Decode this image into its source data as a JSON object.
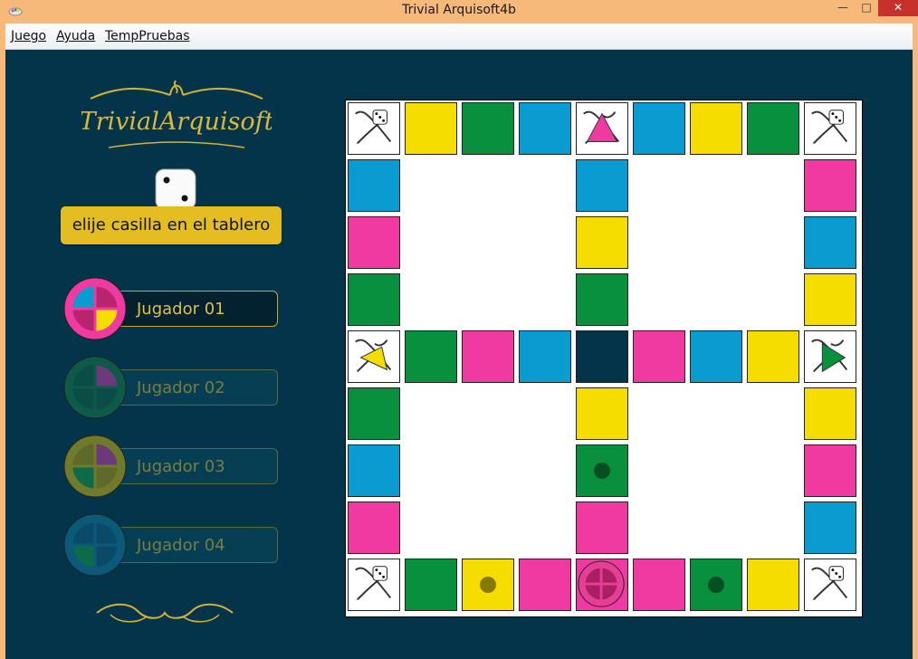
{
  "window": {
    "title": "Trivial Arquisoft4b",
    "icon": "app-icon",
    "controls": [
      "minimize",
      "maximize",
      "close"
    ]
  },
  "menu": [
    {
      "label": "Juego"
    },
    {
      "label": "Ayuda"
    },
    {
      "label": "TempPruebas"
    }
  ],
  "logo": {
    "text": "TrivialArquisoft"
  },
  "status": {
    "text": "elije casilla en el tablero"
  },
  "die": {
    "value": 2
  },
  "players": [
    {
      "name": "Jugador 01",
      "active": true
    },
    {
      "name": "Jugador 02",
      "active": false
    },
    {
      "name": "Jugador 03",
      "active": false
    },
    {
      "name": "Jugador 04",
      "active": false
    }
  ],
  "colors": {
    "yellow": "#f5dd00",
    "green": "#08903f",
    "blue": "#0a9cd0",
    "pink": "#f13aa1",
    "dark": "#04344a",
    "white": "#ffffff",
    "gold": "#e3bd21"
  },
  "board": {
    "size": 9,
    "cells": [
      {
        "r": 0,
        "c": 0,
        "color": "white",
        "icon": "dice-scroll-icon"
      },
      {
        "r": 0,
        "c": 1,
        "color": "yellow"
      },
      {
        "r": 0,
        "c": 2,
        "color": "green"
      },
      {
        "r": 0,
        "c": 3,
        "color": "blue"
      },
      {
        "r": 0,
        "c": 4,
        "color": "white",
        "icon": "pink-wedge-icon"
      },
      {
        "r": 0,
        "c": 5,
        "color": "blue"
      },
      {
        "r": 0,
        "c": 6,
        "color": "yellow"
      },
      {
        "r": 0,
        "c": 7,
        "color": "green"
      },
      {
        "r": 0,
        "c": 8,
        "color": "white",
        "icon": "dice-scroll-icon"
      },
      {
        "r": 1,
        "c": 0,
        "color": "blue"
      },
      {
        "r": 1,
        "c": 4,
        "color": "blue"
      },
      {
        "r": 1,
        "c": 8,
        "color": "pink"
      },
      {
        "r": 2,
        "c": 0,
        "color": "pink"
      },
      {
        "r": 2,
        "c": 4,
        "color": "yellow"
      },
      {
        "r": 2,
        "c": 8,
        "color": "blue"
      },
      {
        "r": 3,
        "c": 0,
        "color": "green"
      },
      {
        "r": 3,
        "c": 4,
        "color": "green"
      },
      {
        "r": 3,
        "c": 8,
        "color": "yellow"
      },
      {
        "r": 4,
        "c": 0,
        "color": "white",
        "icon": "yellow-wedge-icon"
      },
      {
        "r": 4,
        "c": 1,
        "color": "green"
      },
      {
        "r": 4,
        "c": 2,
        "color": "pink"
      },
      {
        "r": 4,
        "c": 3,
        "color": "blue"
      },
      {
        "r": 4,
        "c": 4,
        "color": "dark"
      },
      {
        "r": 4,
        "c": 5,
        "color": "pink"
      },
      {
        "r": 4,
        "c": 6,
        "color": "blue"
      },
      {
        "r": 4,
        "c": 7,
        "color": "yellow"
      },
      {
        "r": 4,
        "c": 8,
        "color": "white",
        "icon": "green-wedge-icon"
      },
      {
        "r": 5,
        "c": 0,
        "color": "green"
      },
      {
        "r": 5,
        "c": 4,
        "color": "yellow"
      },
      {
        "r": 5,
        "c": 8,
        "color": "yellow"
      },
      {
        "r": 6,
        "c": 0,
        "color": "blue"
      },
      {
        "r": 6,
        "c": 4,
        "color": "green",
        "marker": "dot"
      },
      {
        "r": 6,
        "c": 8,
        "color": "pink"
      },
      {
        "r": 7,
        "c": 0,
        "color": "pink"
      },
      {
        "r": 7,
        "c": 4,
        "color": "pink"
      },
      {
        "r": 7,
        "c": 8,
        "color": "blue"
      },
      {
        "r": 8,
        "c": 0,
        "color": "white",
        "icon": "dice-scroll-icon"
      },
      {
        "r": 8,
        "c": 1,
        "color": "green"
      },
      {
        "r": 8,
        "c": 2,
        "color": "yellow",
        "marker": "dot"
      },
      {
        "r": 8,
        "c": 3,
        "color": "pink"
      },
      {
        "r": 8,
        "c": 4,
        "color": "pink",
        "marker": "player-token"
      },
      {
        "r": 8,
        "c": 5,
        "color": "pink"
      },
      {
        "r": 8,
        "c": 6,
        "color": "green",
        "marker": "dot"
      },
      {
        "r": 8,
        "c": 7,
        "color": "yellow"
      },
      {
        "r": 8,
        "c": 8,
        "color": "white",
        "icon": "dice-scroll-icon"
      }
    ]
  }
}
